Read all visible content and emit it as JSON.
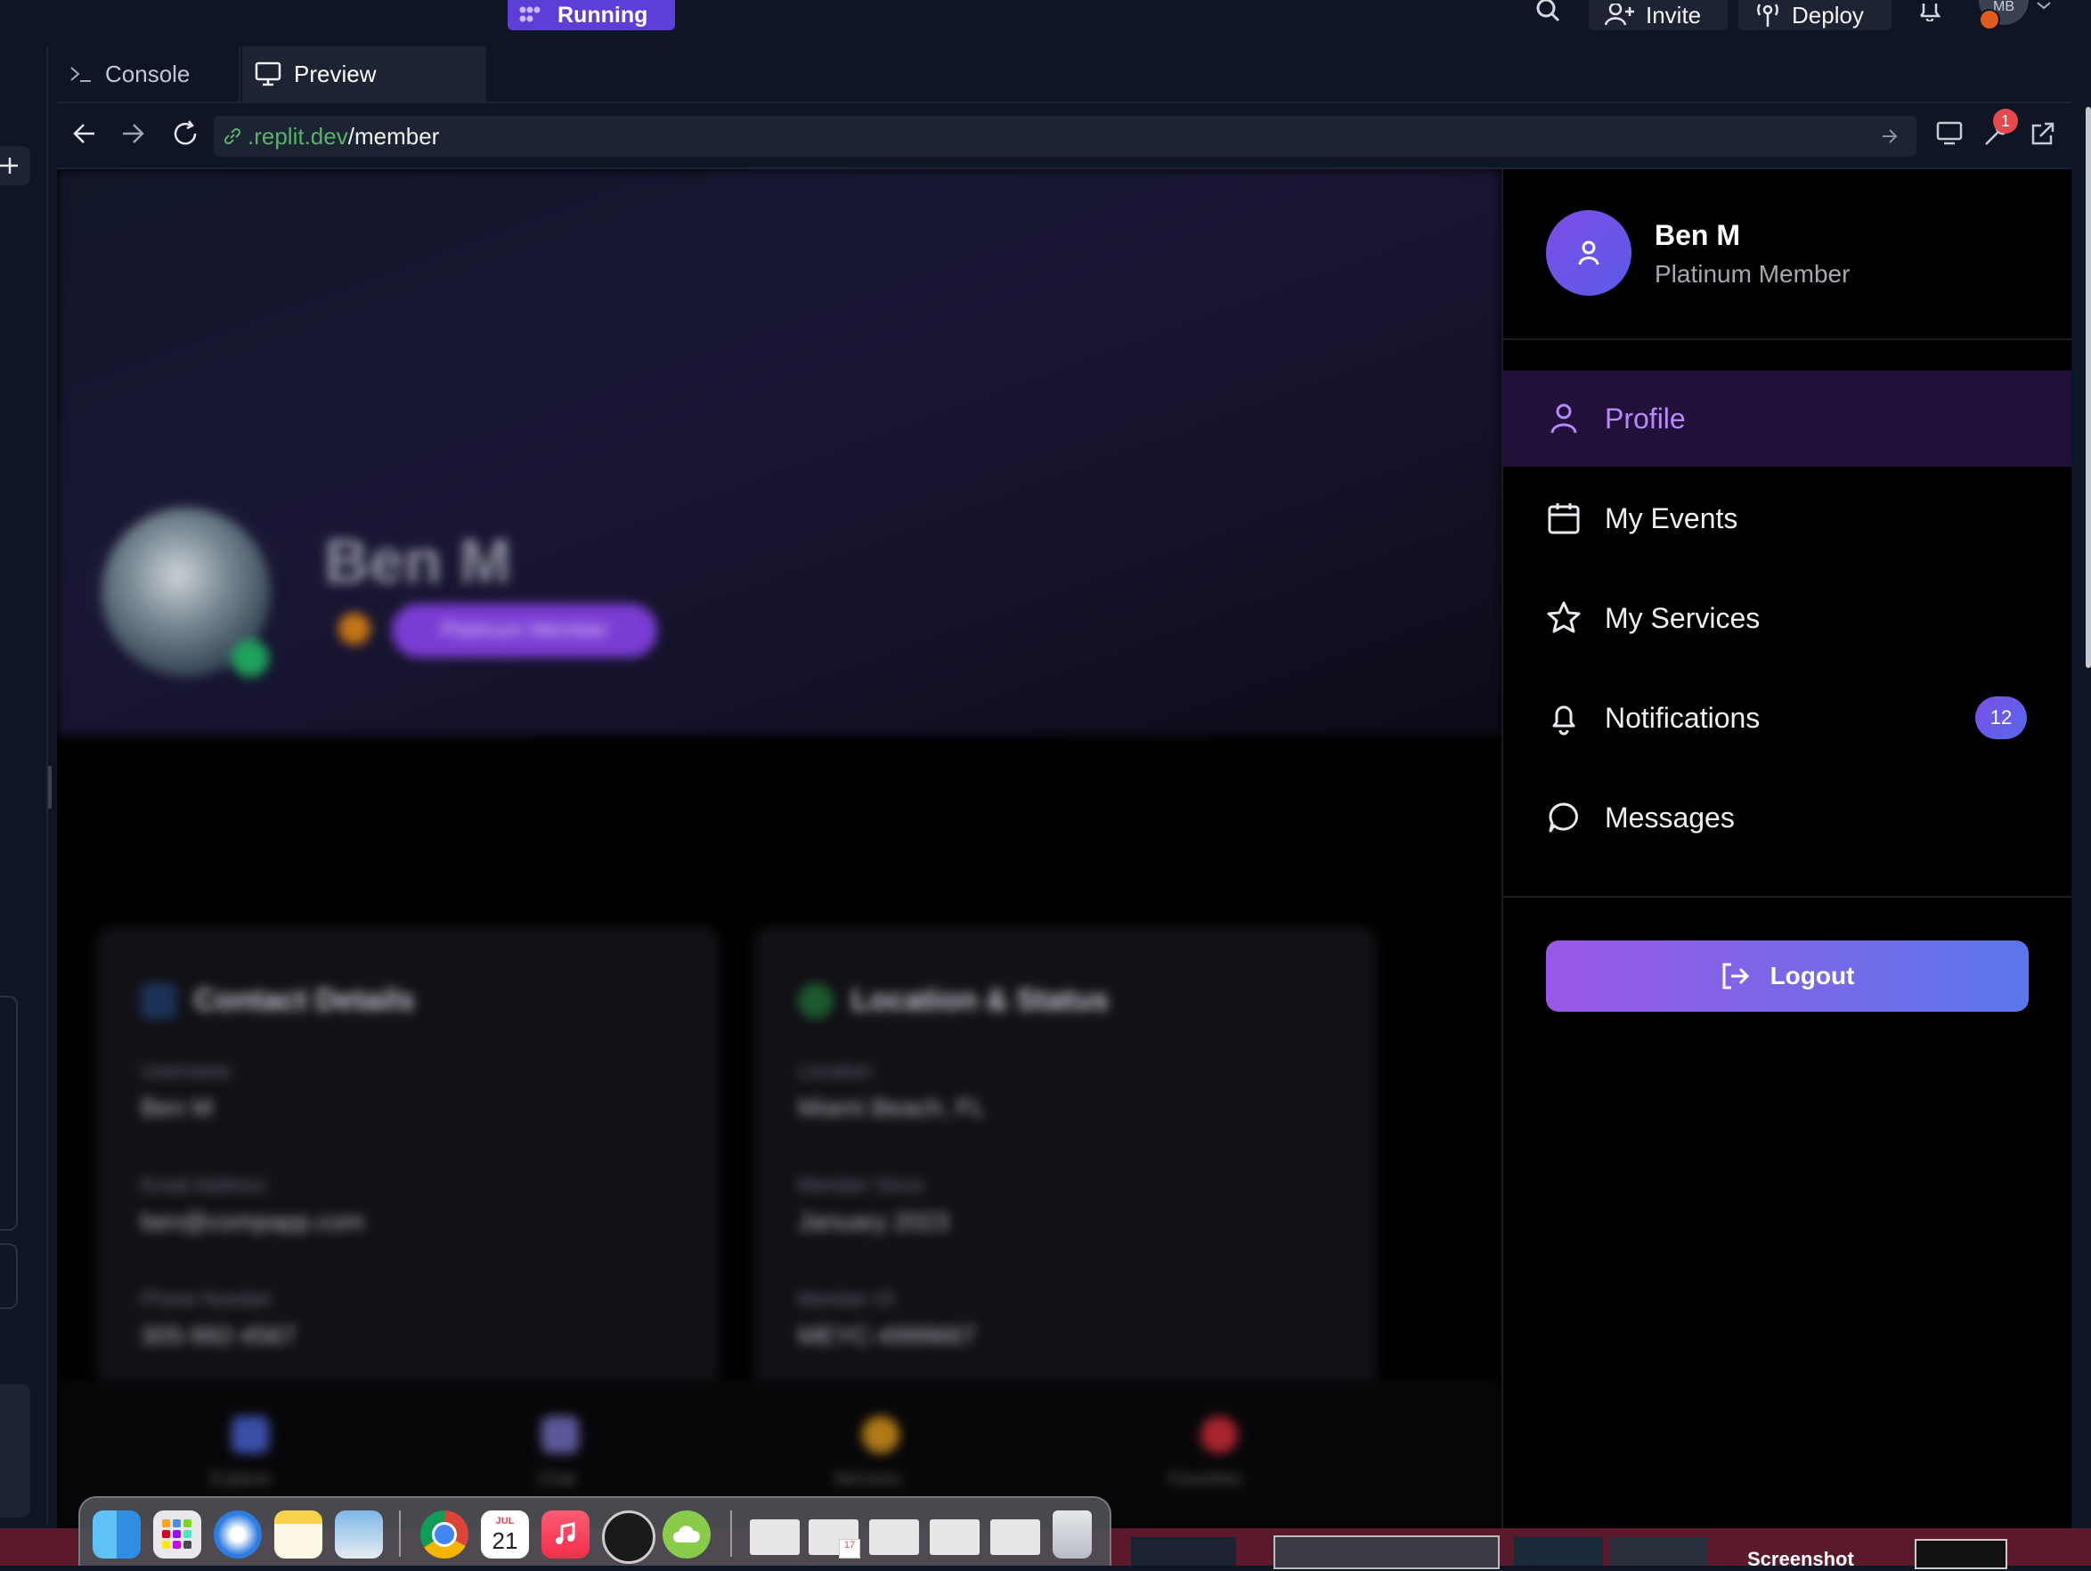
{
  "topbar": {
    "run_label": "Running",
    "invite_label": "Invite",
    "deploy_label": "Deploy",
    "avatar_initials": "MB"
  },
  "tabs": {
    "console_label": "Console",
    "preview_label": "Preview"
  },
  "url": {
    "host": ".replit.dev",
    "path": "/member"
  },
  "devtools_badge": "1",
  "page": {
    "name": "Ben M",
    "tier": "Platinum Member",
    "contact_card": {
      "title": "Contact Details",
      "fields": [
        {
          "label": "Username",
          "value": "Ben M"
        },
        {
          "label": "Email Address",
          "value": "ben@compapp.com"
        },
        {
          "label": "Phone Number",
          "value": "305-992-4567"
        }
      ]
    },
    "location_card": {
      "title": "Location & Status",
      "fields": [
        {
          "label": "Location",
          "value": "Miami Beach, FL"
        },
        {
          "label": "Member Since",
          "value": "January 2023"
        },
        {
          "label": "Member ID",
          "value": "MEYC-4999667"
        }
      ]
    },
    "bottom_nav": [
      "Explore",
      "Chat",
      "Services",
      "Favorites"
    ]
  },
  "drawer": {
    "user_name": "Ben M",
    "user_tier": "Platinum Member",
    "menu": [
      {
        "label": "Profile",
        "icon": "user-icon",
        "active": true
      },
      {
        "label": "My Events",
        "icon": "calendar-icon"
      },
      {
        "label": "My Services",
        "icon": "star-icon"
      },
      {
        "label": "Notifications",
        "icon": "bell-icon",
        "badge": "12"
      },
      {
        "label": "Messages",
        "icon": "message-icon"
      }
    ],
    "logout_label": "Logout"
  },
  "dock": {
    "calendar_month": "JUL",
    "calendar_day": "21",
    "window_badge": "17"
  },
  "desktop": {
    "screenshot_label": "Screenshot"
  },
  "colors": {
    "accent_purple": "#b689ff",
    "active_bg": "#20103a",
    "logout_gradient_start": "#9a57e8",
    "logout_gradient_end": "#5b77e9",
    "url_host": "#59b36a",
    "running": "#5b3fd6"
  }
}
